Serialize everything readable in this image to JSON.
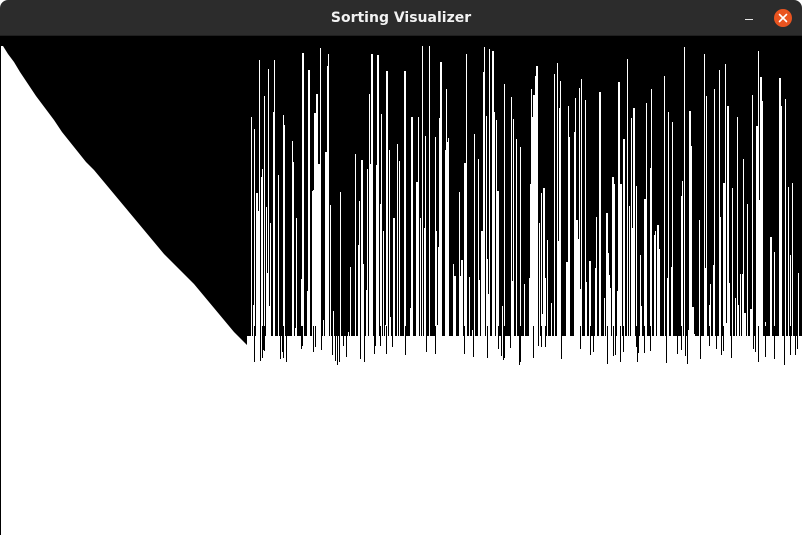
{
  "window": {
    "title": "Sorting Visualizer"
  },
  "colors": {
    "titlebar": "#2c2c2c",
    "title_text": "#f2f2f2",
    "close_button": "#e95420",
    "canvas_background": "#ffffff",
    "bar_fill": "#000000"
  }
}
